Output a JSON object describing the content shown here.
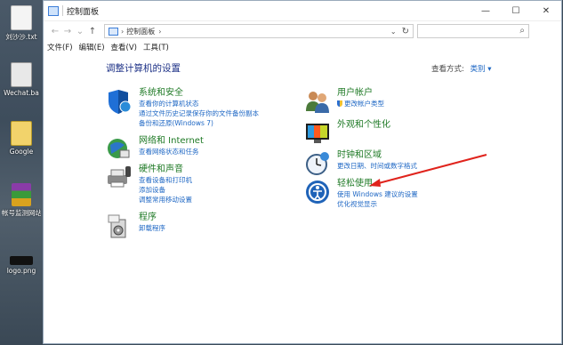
{
  "desktop": {
    "icons": [
      {
        "label": "刘沙沙.txt"
      },
      {
        "label": "Wechat.ba"
      },
      {
        "label": "Google"
      },
      {
        "label": "帐号监测网站"
      },
      {
        "label": "logo.png"
      }
    ]
  },
  "window": {
    "title": "控制面板",
    "controls": {
      "minimize": "—",
      "maximize": "☐",
      "close": "✕"
    }
  },
  "navigation": {
    "back": "←",
    "forward": "→",
    "recent": "⌄",
    "up": "↑",
    "breadcrumb": "控制面板",
    "search_placeholder": ""
  },
  "menu": [
    "文件(F)",
    "编辑(E)",
    "查看(V)",
    "工具(T)"
  ],
  "main": {
    "heading": "调整计算机的设置",
    "view_by_label": "查看方式:",
    "view_by_value": "类别 ▾"
  },
  "categories_left": [
    {
      "title": "系统和安全",
      "links": [
        "查看你的计算机状态",
        "通过文件历史记录保存你的文件备份副本",
        "备份和还原(Windows 7)"
      ],
      "icon": "system-security-icon"
    },
    {
      "title": "网络和 Internet",
      "links": [
        "查看网络状态和任务"
      ],
      "icon": "network-icon"
    },
    {
      "title": "硬件和声音",
      "links": [
        "查看设备和打印机",
        "添加设备",
        "调整常用移动设置"
      ],
      "icon": "hardware-sound-icon"
    },
    {
      "title": "程序",
      "links": [
        "卸载程序"
      ],
      "icon": "programs-icon"
    }
  ],
  "categories_right": [
    {
      "title": "用户帐户",
      "links": [
        "更改帐户类型"
      ],
      "icon": "user-accounts-icon"
    },
    {
      "title": "外观和个性化",
      "links": [],
      "icon": "appearance-icon"
    },
    {
      "title": "时钟和区域",
      "links": [
        "更改日期、时间或数字格式"
      ],
      "icon": "clock-region-icon"
    },
    {
      "title": "轻松使用",
      "links": [
        "使用 Windows 建议的设置",
        "优化视觉显示"
      ],
      "icon": "ease-of-access-icon"
    }
  ],
  "colors": {
    "category_title": "#1f7a26",
    "link": "#1e67c4",
    "heading": "#1e3287",
    "annotation_arrow": "#e0231c"
  }
}
